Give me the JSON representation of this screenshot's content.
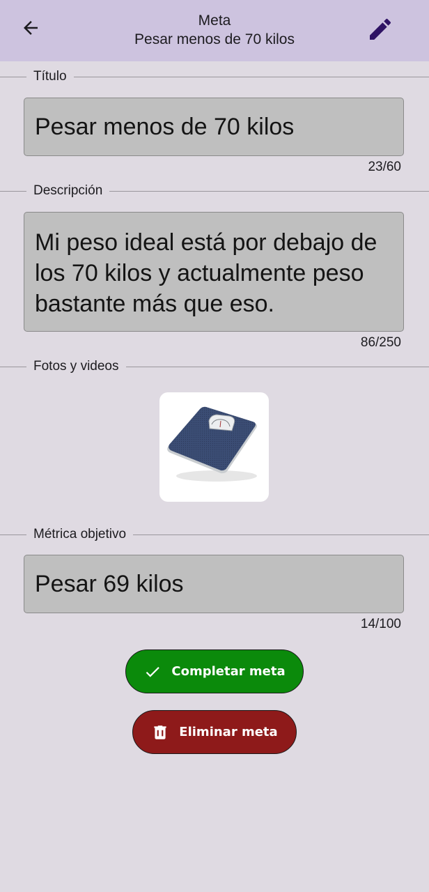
{
  "appbar": {
    "title": "Meta",
    "subtitle": "Pesar menos de 70 kilos",
    "back_icon": "arrow-back-icon",
    "edit_icon": "pencil-icon",
    "background": "#cdc3df",
    "edit_icon_color": "#2e1264"
  },
  "sections": {
    "titulo": {
      "label": "Título",
      "value": "Pesar menos de 70 kilos",
      "counter": "23/60"
    },
    "descripcion": {
      "label": "Descripción",
      "value": "Mi peso ideal está por debajo de los 70 kilos y actualmente peso bastante más que eso.",
      "counter": "86/250"
    },
    "fotos": {
      "label": "Fotos y videos",
      "photo_icon": "bathroom-scale-image"
    },
    "metrica": {
      "label": "Métrica objetivo",
      "value": "Pesar 69 kilos",
      "counter": "14/100"
    }
  },
  "actions": {
    "complete": {
      "label": "Completar meta",
      "icon": "check-icon",
      "color": "#0b8a0b"
    },
    "delete": {
      "label": "Eliminar meta",
      "icon": "trash-icon",
      "color": "#8e1a1a"
    }
  }
}
